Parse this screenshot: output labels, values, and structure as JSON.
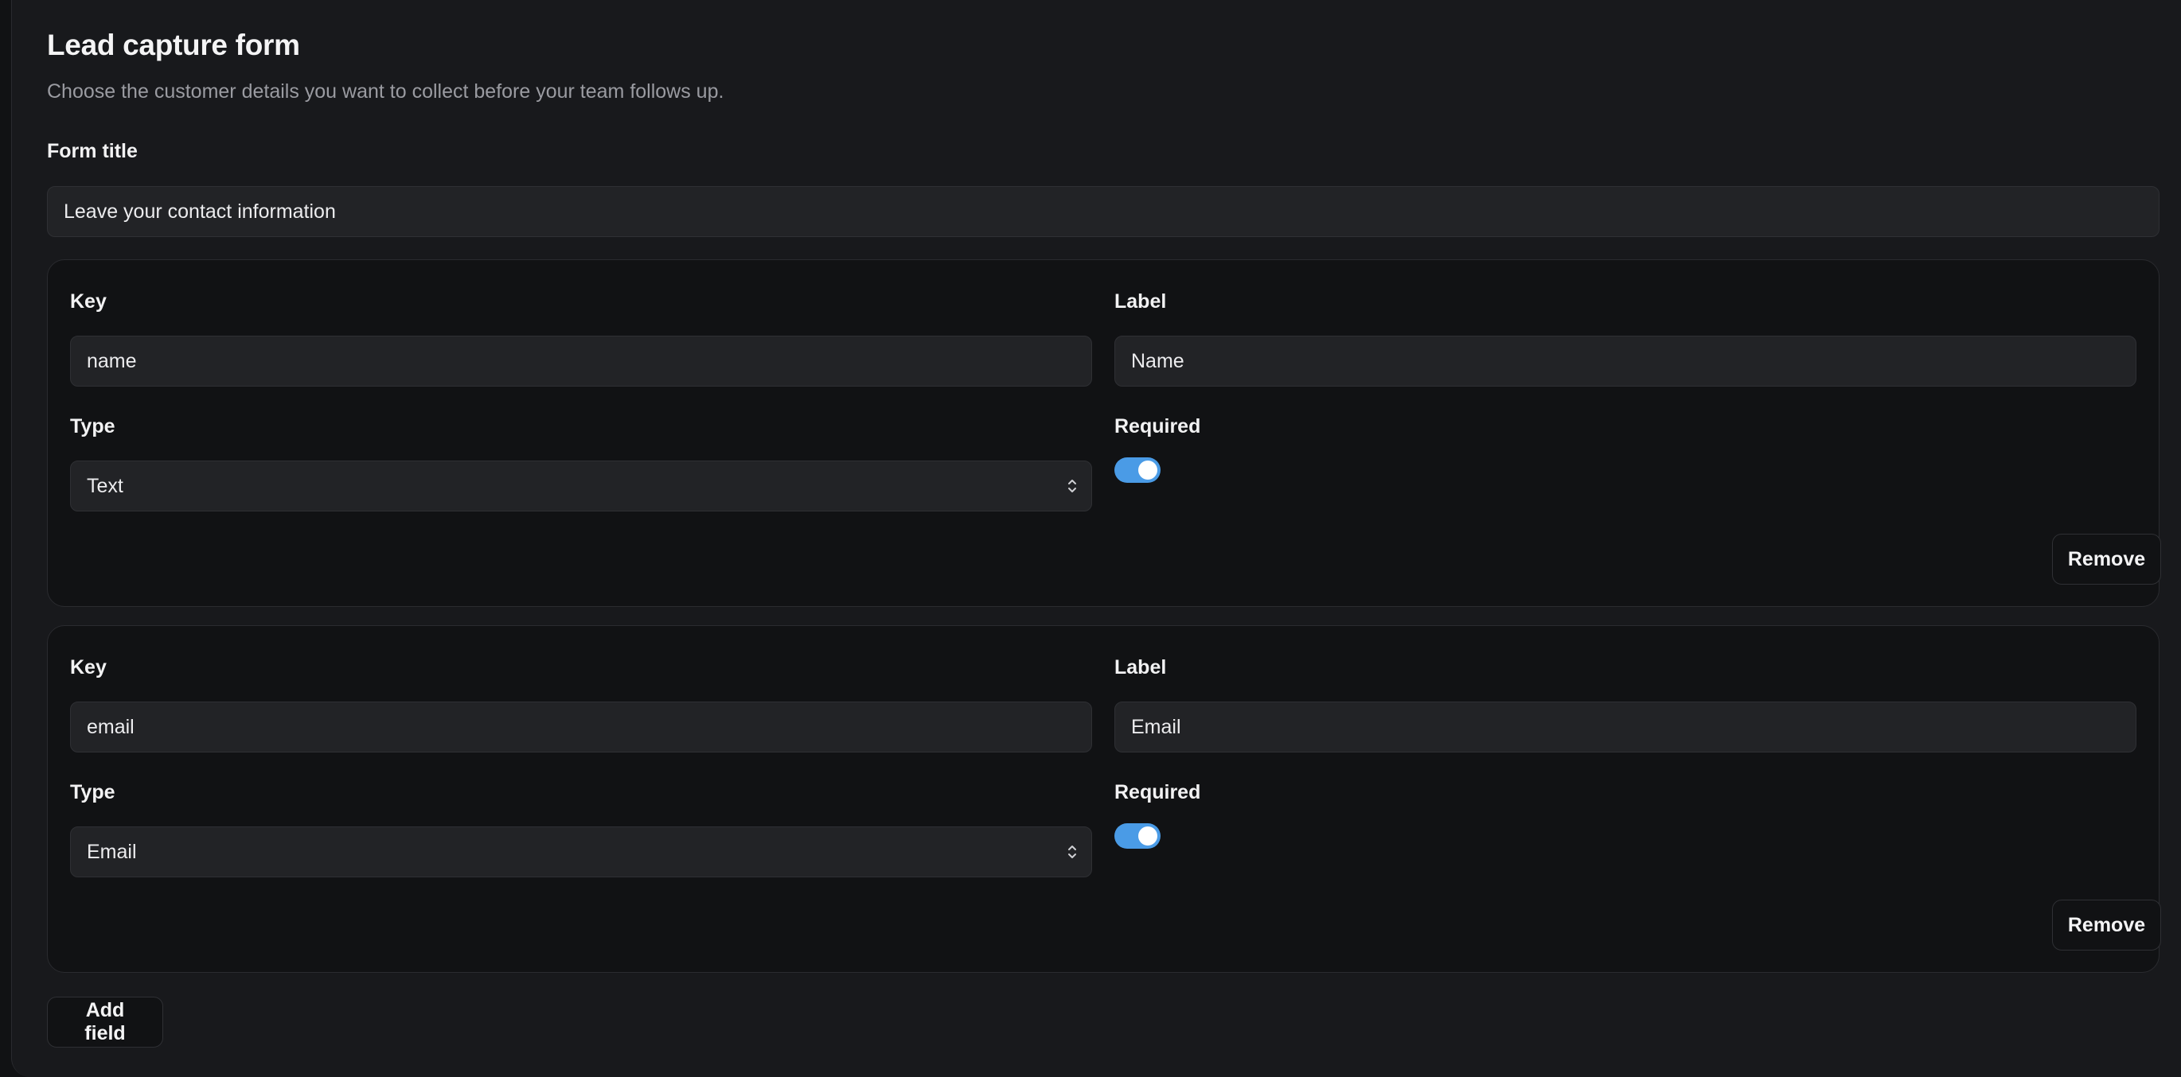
{
  "header": {
    "title": "Lead capture form",
    "subtitle": "Choose the customer details you want to collect before your team follows up."
  },
  "form_title": {
    "label": "Form title",
    "value": "Leave your contact information"
  },
  "fields": [
    {
      "key_label": "Key",
      "key_value": "name",
      "label_label": "Label",
      "label_value": "Name",
      "type_label": "Type",
      "type_value": "Text",
      "required_label": "Required",
      "required": true,
      "remove_label": "Remove"
    },
    {
      "key_label": "Key",
      "key_value": "email",
      "label_label": "Label",
      "label_value": "Email",
      "type_label": "Type",
      "type_value": "Email",
      "required_label": "Required",
      "required": true,
      "remove_label": "Remove"
    }
  ],
  "add_field_label": "Add field",
  "icons": {
    "select": "chevron-up-down-icon"
  },
  "colors": {
    "toggle_on": "#4a9be6",
    "background": "#18191c",
    "card": "#111214"
  }
}
